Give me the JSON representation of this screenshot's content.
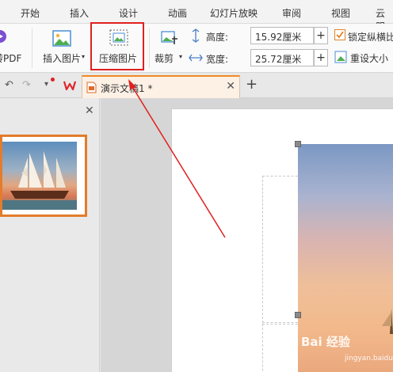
{
  "menu": {
    "tabs": [
      "开始",
      "插入",
      "设计",
      "动画",
      "幻灯片放映",
      "审阅",
      "视图",
      "云服"
    ]
  },
  "ribbon": {
    "to_pdf_label": "转PDF",
    "insert_picture_label": "插入图片",
    "compress_picture_label": "压缩图片",
    "crop_label": "裁剪",
    "height_label": "高度:",
    "height_value": "15.92厘米",
    "width_label": "宽度:",
    "width_value": "25.72厘米",
    "lock_ratio_label": "锁定纵横比",
    "reset_size_label": "重设大小"
  },
  "doc_tab": {
    "title": "演示文稿1 *"
  },
  "watermark": {
    "text": "Bai 经验",
    "sub": "jingyan.baidu.com"
  },
  "colors": {
    "highlight": "#e02020",
    "tab_accent": "#f08a28",
    "thumb_border": "#e37c2b"
  }
}
